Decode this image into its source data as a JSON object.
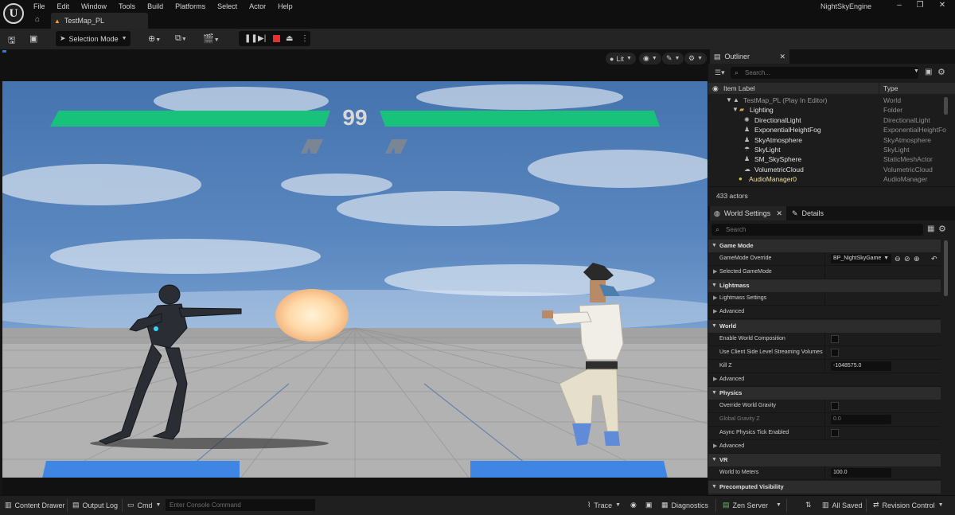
{
  "window": {
    "logo": "U",
    "menu": [
      "File",
      "Edit",
      "Window",
      "Tools",
      "Build",
      "Platforms",
      "Select",
      "Actor",
      "Help"
    ],
    "tab_label": "TestMap_PL",
    "app_name": "NightSkyEngine"
  },
  "toolbar": {
    "selection_mode": "Selection Mode",
    "icons": [
      "save-icon",
      "content-browser-icon",
      "add-actor-icon",
      "blueprint-icon",
      "cinematics-icon",
      "pause-icon",
      "step-icon",
      "stop-icon",
      "eject-icon",
      "more-icon"
    ]
  },
  "viewport": {
    "lit_label": "Lit",
    "game": {
      "timer": "99",
      "player1_health_pct": 100,
      "player2_health_pct": 100
    }
  },
  "outliner": {
    "tab_label": "Outliner",
    "search_placeholder": "Search...",
    "col_label": "Item Label",
    "col_type": "Type",
    "rows": [
      {
        "name": "TestMap_PL (Play In Editor)",
        "type": "World"
      },
      {
        "name": "Lighting",
        "type": "Folder"
      },
      {
        "name": "DirectionalLight",
        "type": "DirectionalLight"
      },
      {
        "name": "ExponentialHeightFog",
        "type": "ExponentialHeightFo"
      },
      {
        "name": "SkyAtmosphere",
        "type": "SkyAtmosphere"
      },
      {
        "name": "SkyLight",
        "type": "SkyLight"
      },
      {
        "name": "SM_SkySphere",
        "type": "StaticMeshActor"
      },
      {
        "name": "VolumetricCloud",
        "type": "VolumetricCloud"
      },
      {
        "name": "AudioManager0",
        "type": "AudioManager"
      }
    ],
    "actor_count": "433 actors"
  },
  "details": {
    "tab_world_settings": "World Settings",
    "tab_details": "Details",
    "search_placeholder": "Search",
    "sections": {
      "game_mode": "Game Mode",
      "lightmass": "Lightmass",
      "world": "World",
      "physics": "Physics",
      "vr": "VR",
      "precomputed": "Precomputed Visibility"
    },
    "props": {
      "gamemode_override": "GameMode Override",
      "gamemode_value": "BP_NightSkyGame",
      "selected_gamemode": "Selected GameMode",
      "lightmass_settings": "Lightmass Settings",
      "advanced": "Advanced",
      "enable_world_composition": "Enable World Composition",
      "client_side_streaming": "Use Client Side Level Streaming Volumes",
      "kill_z": "Kill Z",
      "kill_z_value": "-1048575.0",
      "override_gravity": "Override World Gravity",
      "global_gravity_z": "Global Gravity Z",
      "global_gravity_value": "0.0",
      "async_physics": "Async Physics Tick Enabled",
      "world_to_meters": "World to Meters",
      "world_to_meters_value": "100.0"
    }
  },
  "statusbar": {
    "content_drawer": "Content Drawer",
    "output_log": "Output Log",
    "cmd": "Cmd",
    "console_placeholder": "Enter Console Command",
    "trace": "Trace",
    "diagnostics": "Diagnostics",
    "zen_server": "Zen Server",
    "all_saved": "All Saved",
    "revision_control": "Revision Control"
  }
}
